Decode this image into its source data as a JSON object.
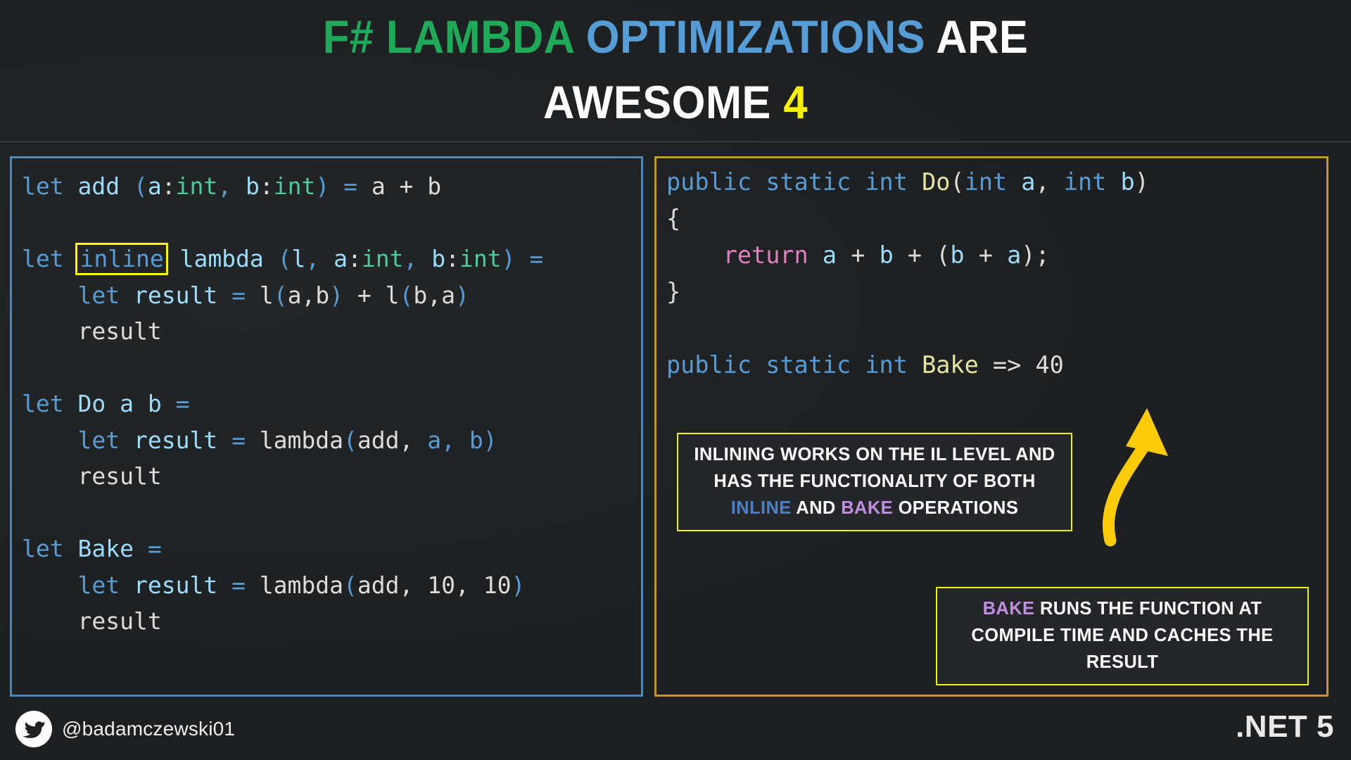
{
  "title": {
    "line1": [
      {
        "text": "F# LAMBDA ",
        "color": "#1faa59",
        "cls": "t-green"
      },
      {
        "text": "OPTIMIZATIONS ",
        "color": "#569cd6",
        "cls": "t-blue"
      },
      {
        "text": "ARE",
        "color": "#ffffff",
        "cls": "t-white"
      }
    ],
    "line2": [
      {
        "text": "AWESOME ",
        "color": "#ffffff",
        "cls": "t-white"
      },
      {
        "text": "4",
        "color": "#f9f007",
        "cls": "t-yellow"
      }
    ],
    "full_text": "F# LAMBDA OPTIMIZATIONS ARE AWESOME 4"
  },
  "left_panel": {
    "language": "F#",
    "border_color": "#4a87bd",
    "highlight_keyword": "inline",
    "highlight_border_color": "#ffff00",
    "code_text": "let add (a:int, b:int) = a + b\n\nlet inline lambda (l, a:int, b:int) =\n    let result = l(a,b) + l(b,a)\n    result\n\nlet Do a b =\n    let result = lambda(add, a, b)\n    result\n\nlet Bake =\n    let result = lambda(add, 10, 10)\n    result",
    "lines": [
      "let add (a:int, b:int) = a + b",
      "",
      "let inline lambda (l, a:int, b:int) =",
      "    let result = l(a,b) + l(b,a)",
      "    result",
      "",
      "let Do a b =",
      "    let result = lambda(add, a, b)",
      "    result",
      "",
      "let Bake =",
      "    let result = lambda(add, 10, 10)",
      "    result"
    ]
  },
  "right_panel": {
    "language": "C#",
    "border_color": "#c9981b",
    "code_text": "public static int Do(int a, int b)\n{\n    return a + b + (b + a);\n}\n\npublic static int Bake => 40",
    "lines": [
      "public static int Do(int a, int b)",
      "{",
      "    return a + b + (b + a);",
      "}",
      "",
      "public static int Bake => 40"
    ],
    "bake_value": "40"
  },
  "callouts": [
    {
      "name": "inlining-note",
      "border_color": "#f2f20a",
      "text_runs": [
        {
          "text": "INLINING WORKS ON THE IL LEVEL AND HAS THE FUNCTIONALITY OF BOTH ",
          "color": "#ffffff"
        },
        {
          "text": "INLINE",
          "color": "#4a7fc1"
        },
        {
          "text": " AND ",
          "color": "#ffffff"
        },
        {
          "text": "BAKE",
          "color": "#c08ee0"
        },
        {
          "text": " OPERATIONS",
          "color": "#ffffff"
        }
      ],
      "plain_text": "INLINING WORKS ON THE IL LEVEL AND HAS THE FUNCTIONALITY OF BOTH INLINE AND BAKE OPERATIONS",
      "segments": {
        "pre": "INLINING WORKS ON THE IL LEVEL AND HAS THE FUNCTIONALITY OF BOTH",
        "kw1": "INLINE",
        "mid": "AND",
        "kw2": "BAKE",
        "post": "OPERATIONS"
      }
    },
    {
      "name": "bake-note",
      "border_color": "#f2f20a",
      "plain_text": "BAKE RUNS THE FUNCTION AT COMPILE TIME AND CACHES THE RESULT",
      "segments": {
        "kw1": "BAKE",
        "rest": "RUNS THE FUNCTION AT COMPILE TIME AND CACHES THE RESULT"
      }
    }
  ],
  "arrow": {
    "name": "curved-up-arrow",
    "color": "#fdcb0a",
    "direction": "up"
  },
  "footer": {
    "twitter_icon": "twitter-bird-icon",
    "handle": "@badamczewski01",
    "dotnet_version": ".NET 5"
  },
  "theme": {
    "background": "#1d1f21",
    "keyword_blue": "#569cd6",
    "identifier_light_blue": "#9cdcfe",
    "type_green": "#4ec9a0",
    "method_yellow": "#e8e3a0",
    "return_pink": "#e07fc0",
    "plain_text": "#dcdcdc",
    "accent_yellow": "#f2f20a",
    "accent_gold": "#c9981b",
    "accent_blue": "#4a87bd"
  }
}
